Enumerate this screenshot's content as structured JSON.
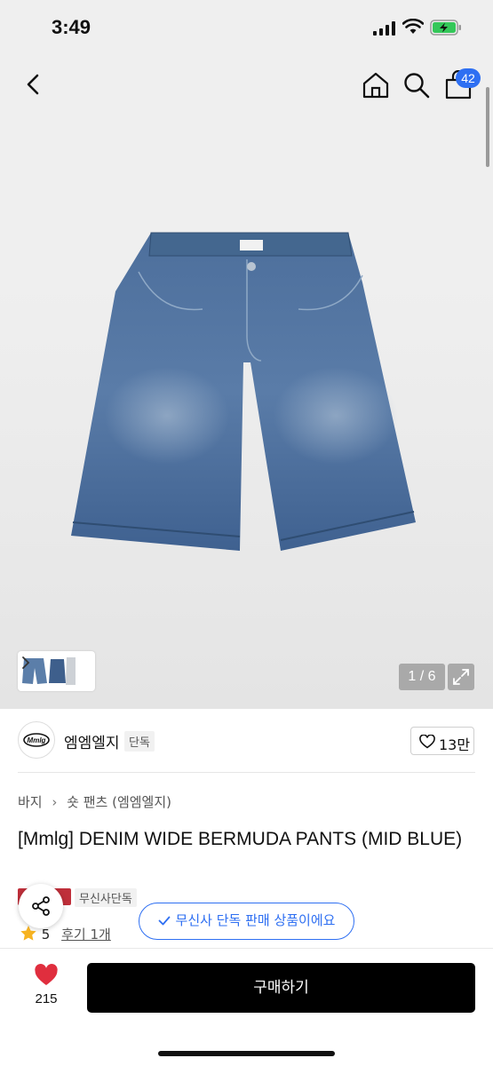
{
  "status_bar": {
    "time": "3:49"
  },
  "header": {
    "back_icon": "chevron-left-icon",
    "home_icon": "home-icon",
    "search_icon": "search-icon",
    "cart_icon": "shopping-bag-icon",
    "cart_badge": "42"
  },
  "gallery": {
    "page_indicator": "1 / 6",
    "expand_icon": "expand-arrows-icon",
    "thumbnail_arrow_icon": "chevron-right-icon"
  },
  "brand": {
    "logo_text": "Mmlg",
    "name": "엠엠엘지",
    "exclusive_label": "단독",
    "like_count": "13만"
  },
  "breadcrumb": {
    "items": [
      "바지",
      "숏 팬츠 (엠엠엘지)"
    ]
  },
  "product": {
    "title": "[Mmlg] DENIM WIDE BERMUDA PANTS (MID BLUE)",
    "tags": [
      "무신사단독"
    ],
    "rating": "5",
    "review_link": "후기 1개"
  },
  "toast": {
    "text": "무신사 단독 판매 상품이에요"
  },
  "bottom_bar": {
    "wish_count": "215",
    "buy_label": "구매하기"
  },
  "colors": {
    "accent_blue": "#2e6ff2",
    "heart_red": "#e02e3e",
    "buy_button": "#000000",
    "denim": "#4a6d9a"
  }
}
